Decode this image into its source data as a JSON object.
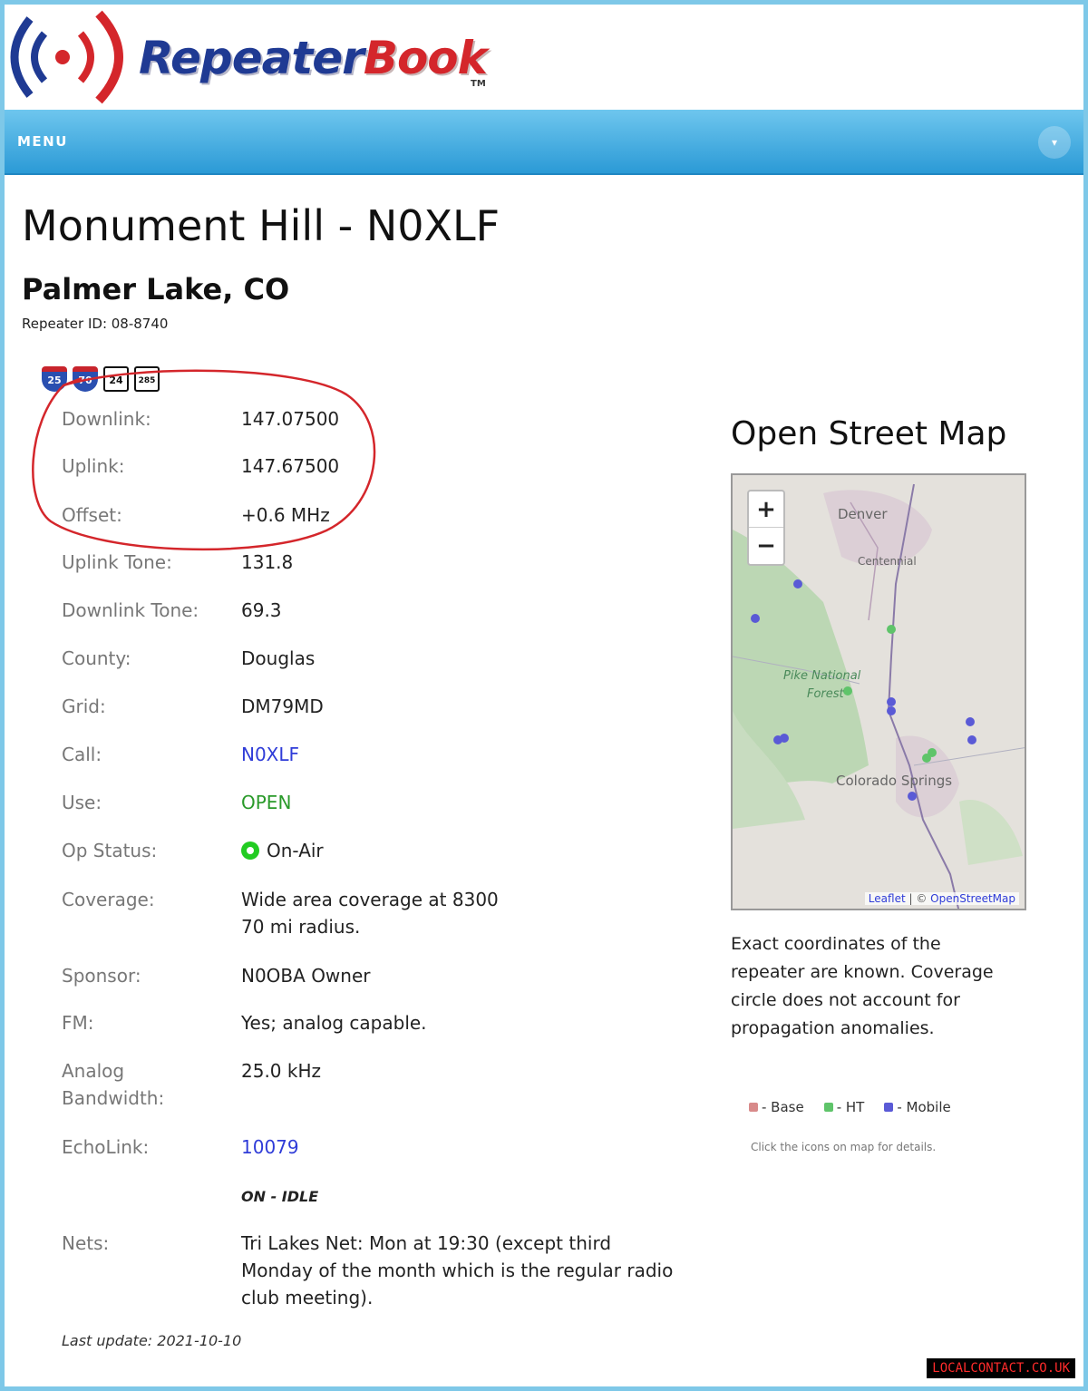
{
  "brand": {
    "name_part1": "Repeater",
    "name_part2": "Book",
    "tm": "TM"
  },
  "menu": {
    "label": "MENU"
  },
  "repeater": {
    "title": "Monument Hill - N0XLF",
    "location": "Palmer Lake, CO",
    "repeater_id": "Repeater ID: 08-8740",
    "shields": [
      "25",
      "70",
      "24",
      "285"
    ]
  },
  "details": {
    "downlink": {
      "label": "Downlink:",
      "value": "147.07500"
    },
    "uplink": {
      "label": "Uplink:",
      "value": "147.67500"
    },
    "offset": {
      "label": "Offset:",
      "value": "+0.6 MHz"
    },
    "uplink_tone": {
      "label": "Uplink Tone:",
      "value": "131.8"
    },
    "downlink_tone": {
      "label": "Downlink Tone:",
      "value": "69.3"
    },
    "county": {
      "label": "County:",
      "value": "Douglas"
    },
    "grid": {
      "label": "Grid:",
      "value": "DM79MD"
    },
    "call": {
      "label": "Call:",
      "value": "N0XLF"
    },
    "use": {
      "label": "Use:",
      "value": "OPEN"
    },
    "op_status": {
      "label": "Op Status:",
      "value": "On-Air"
    },
    "coverage": {
      "label": "Coverage:",
      "line1": "Wide area coverage at 8300",
      "line2": "70 mi radius."
    },
    "sponsor": {
      "label": "Sponsor:",
      "value": "N0OBA Owner"
    },
    "fm": {
      "label": "FM:",
      "value": "Yes; analog capable."
    },
    "analog_bw": {
      "label1": "Analog",
      "label2": "Bandwidth:",
      "value": "25.0 kHz"
    },
    "echolink": {
      "label": "EchoLink:",
      "value": "10079",
      "status": "ON - IDLE"
    },
    "nets": {
      "label": "Nets:",
      "line1": "Tri Lakes Net: Mon at 19:30 (except third",
      "line2": "Monday of the month which is the regular radio",
      "line3": "club meeting)."
    },
    "last_update": "Last update: 2021-10-10"
  },
  "map": {
    "title": "Open Street Map",
    "zoom_in": "+",
    "zoom_out": "−",
    "labels": {
      "denver": "Denver",
      "centennial": "Centennial",
      "forest1": "Pike National",
      "forest2": "Forest",
      "springs": "Colorado Springs"
    },
    "attrib_leaflet": "Leaflet",
    "attrib_sep": " | © ",
    "attrib_osm": "OpenStreetMap",
    "note": "Exact coordinates of the repeater are known. Coverage circle does not account for propagation anomalies.",
    "legend": {
      "base": "- Base",
      "ht": "- HT",
      "mobile": "- Mobile"
    },
    "hint": "Click the icons on map for details.",
    "colors": {
      "base": "#d88a8a",
      "ht": "#5fc46a",
      "mobile": "#5a5ad6"
    }
  },
  "watermark": "LOCALCONTACT.CO.UK"
}
